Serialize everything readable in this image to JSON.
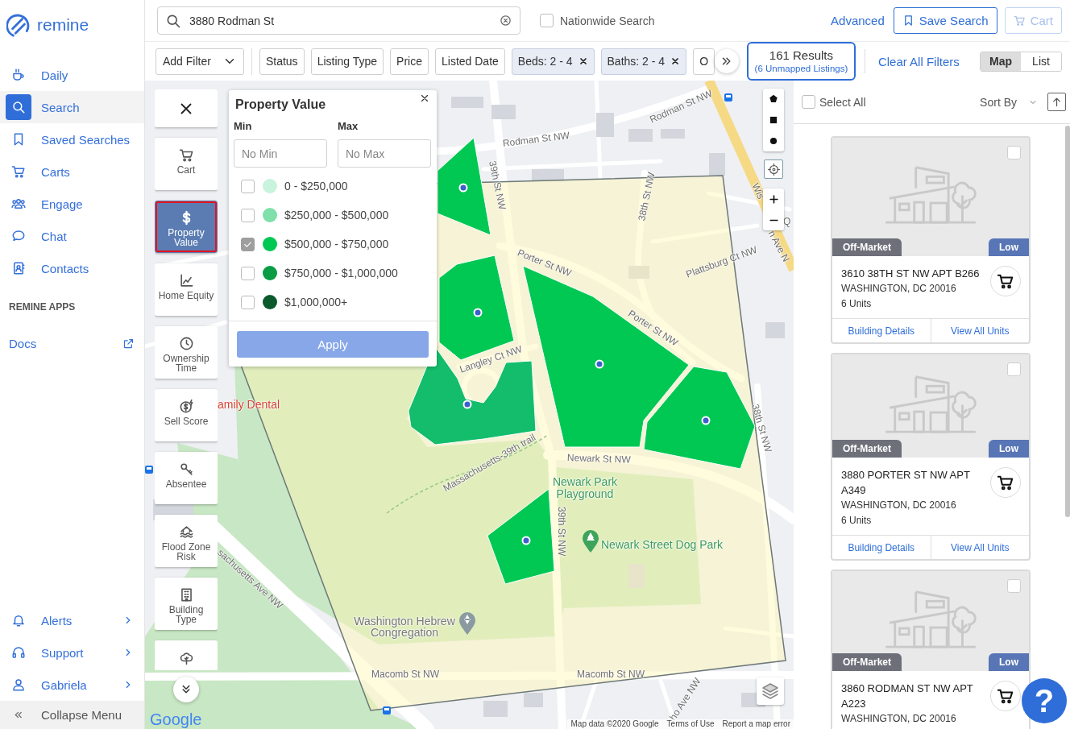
{
  "sidebar": {
    "logo": "remine",
    "nav": [
      {
        "label": "Daily",
        "selected": false
      },
      {
        "label": "Search",
        "selected": true
      },
      {
        "label": "Saved Searches",
        "selected": false
      },
      {
        "label": "Carts",
        "selected": false
      },
      {
        "label": "Engage",
        "selected": false
      },
      {
        "label": "Chat",
        "selected": false
      },
      {
        "label": "Contacts",
        "selected": false
      }
    ],
    "apps_heading": "REMINE APPS",
    "apps": [
      {
        "label": "Docs"
      }
    ],
    "account": [
      {
        "label": "Alerts"
      },
      {
        "label": "Support"
      },
      {
        "label": "Gabriela"
      }
    ],
    "collapse": "Collapse Menu"
  },
  "search_bar": {
    "search": {
      "value": "3880 Rodman St"
    },
    "nationwide": {
      "label": "Nationwide Search",
      "checked": false
    },
    "advanced": "Advanced",
    "save_search": "Save Search",
    "cart": {
      "label": "Cart",
      "disabled": true
    }
  },
  "filter_bar": {
    "add_filter": "Add Filter",
    "chips": [
      {
        "label": "Status",
        "active": false
      },
      {
        "label": "Listing Type",
        "active": false
      },
      {
        "label": "Price",
        "active": false
      },
      {
        "label": "Listed Date",
        "active": false
      },
      {
        "label": "Beds: 2 - 4",
        "active": true
      },
      {
        "label": "Baths: 2 - 4",
        "active": true
      },
      {
        "label": "O",
        "active": false
      }
    ],
    "results": {
      "count": "161 Results",
      "unmapped": "(6 Unmapped Listings)"
    },
    "clear_all": "Clear All Filters",
    "views": [
      {
        "label": "Map",
        "selected": true
      },
      {
        "label": "List",
        "selected": false
      }
    ]
  },
  "map": {
    "tools": [
      {
        "label": "Cart",
        "selected": false
      },
      {
        "label": "Property Value",
        "selected": true
      },
      {
        "label": "Home Equity",
        "selected": false
      },
      {
        "label": "Ownership Time",
        "selected": false
      },
      {
        "label": "Sell Score",
        "selected": false
      },
      {
        "label": "Absentee",
        "selected": false
      },
      {
        "label": "Flood Zone Risk",
        "selected": false
      },
      {
        "label": "Building Type",
        "selected": false
      },
      {
        "selected": false
      }
    ],
    "property_value_filter": {
      "title": "Property Value",
      "min_label": "Min",
      "max_label": "Max",
      "min_placeholder": "No Min",
      "max_placeholder": "No Max",
      "ranges": [
        {
          "label": "0 - $250,000",
          "color": "#c8f3dc",
          "checked": false
        },
        {
          "label": "$250,000 - $500,000",
          "color": "#7fe0a9",
          "checked": false
        },
        {
          "label": "$500,000 - $750,000",
          "color": "#00c853",
          "checked": true
        },
        {
          "label": "$750,000 - $1,000,000",
          "color": "#0a9d45",
          "checked": false
        },
        {
          "label": "$1,000,000+",
          "color": "#0b5a2c",
          "checked": false
        }
      ],
      "apply": "Apply"
    },
    "labels": [
      {
        "text": "Rodman St NW",
        "kind": "street"
      },
      {
        "text": "Rodman St NW",
        "kind": "street"
      },
      {
        "text": "39th St NW",
        "kind": "street"
      },
      {
        "text": "38th St NW",
        "kind": "street"
      },
      {
        "text": "Porter St NW",
        "kind": "street"
      },
      {
        "text": "Porter St NW",
        "kind": "street"
      },
      {
        "text": "Plattsburg Ct NW",
        "kind": "street"
      },
      {
        "text": "Langley Ct NW",
        "kind": "street"
      },
      {
        "text": "Massachusetts-39th trail",
        "kind": "street"
      },
      {
        "text": "Newark St NW",
        "kind": "street"
      },
      {
        "text": "Newark Park Playground",
        "kind": "park"
      },
      {
        "text": "39th St NW",
        "kind": "street"
      },
      {
        "text": "38th St NW",
        "kind": "street"
      },
      {
        "text": "Newark Street Dog Park",
        "kind": "park"
      },
      {
        "text": "Washington Hebrew Congregation",
        "kind": "place"
      },
      {
        "text": "Macomb St NW",
        "kind": "street"
      },
      {
        "text": "Macomb St NW",
        "kind": "street"
      },
      {
        "text": "amily Dental",
        "kind": "business"
      },
      {
        "text": "sachusetts Ave NW",
        "kind": "street"
      },
      {
        "text": "Wis",
        "kind": "street"
      },
      {
        "text": "n Ave N",
        "kind": "street"
      },
      {
        "text": "Q",
        "kind": "street"
      },
      {
        "text": "ho Ave NW",
        "kind": "street"
      }
    ],
    "attribution": {
      "logo": "Google",
      "data": "Map data ©2020 Google",
      "terms": "Terms of Use",
      "report": "Report a map error"
    }
  },
  "results_panel": {
    "select_all": {
      "label": "Select All",
      "checked": false
    },
    "sort_by": "Sort By",
    "listings": [
      {
        "status": "Off-Market",
        "tag": "Low",
        "address": "3610 38TH ST NW APT B266",
        "city": "WASHINGTON, DC 20016",
        "units": "6 Units",
        "checked": false,
        "actions": [
          "Building Details",
          "View All Units"
        ]
      },
      {
        "status": "Off-Market",
        "tag": "Low",
        "address": "3880 PORTER ST NW APT A349",
        "city": "WASHINGTON, DC 20016",
        "units": "6 Units",
        "checked": false,
        "actions": [
          "Building Details",
          "View All Units"
        ]
      },
      {
        "status": "Off-Market",
        "tag": "Low",
        "address": "3860 RODMAN ST NW APT A223",
        "city": "WASHINGTON, DC 20016",
        "checked": false
      }
    ]
  },
  "help": "?"
}
